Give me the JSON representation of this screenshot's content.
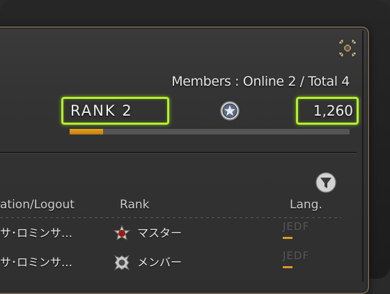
{
  "header": {
    "members_text": "Members : Online 2 / Total 4",
    "rank_label": "RANK 2",
    "points": "1,260",
    "rank_progress": 0.12
  },
  "table": {
    "columns": [
      "ation/Logout",
      "Rank",
      "Lang."
    ],
    "rows": [
      {
        "name": "サ･ロミンサ…",
        "rank": "マスター",
        "rank_icon": "master-rank-icon",
        "lang": "JEDF"
      },
      {
        "name": "サ･ロミンサ…",
        "rank": "メンバー",
        "rank_icon": "member-rank-icon",
        "lang": "JEDF"
      }
    ]
  },
  "colors": {
    "highlight": "#b2f22a",
    "progress": "#d99b26",
    "panel_border": "#6a5f4a"
  },
  "icons": [
    "close-icon",
    "company-credit-icon",
    "filter-icon"
  ]
}
